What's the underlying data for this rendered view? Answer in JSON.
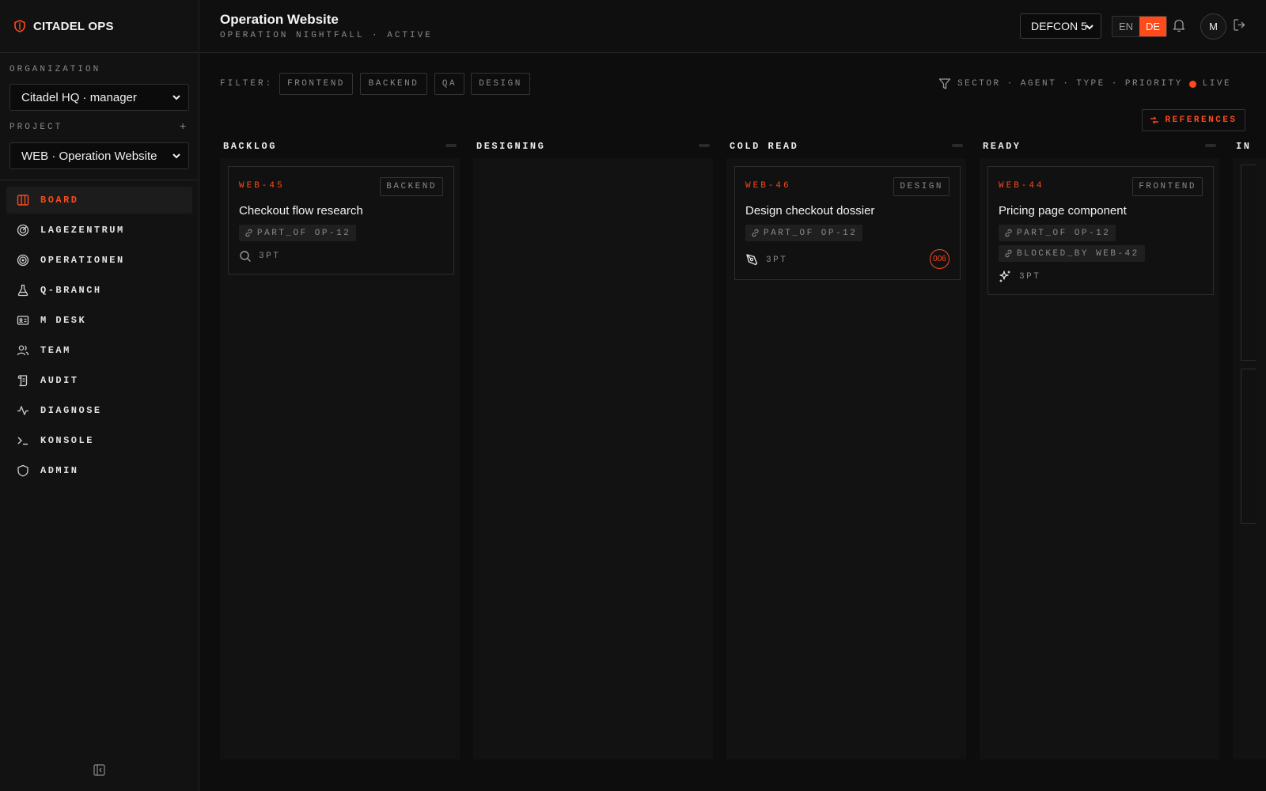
{
  "brand": {
    "name": "CITADEL OPS"
  },
  "sidebar": {
    "org_label": "ORGANIZATION",
    "org_value": "Citadel HQ · manager",
    "project_label": "PROJECT",
    "project_add": "+",
    "project_value": "WEB · Operation Website",
    "items": [
      {
        "label": "BOARD",
        "icon": "board-icon"
      },
      {
        "label": "LAGEZENTRUM",
        "icon": "radar-icon"
      },
      {
        "label": "OPERATIONEN",
        "icon": "target-icon"
      },
      {
        "label": "Q-BRANCH",
        "icon": "flask-icon"
      },
      {
        "label": "M DESK",
        "icon": "id-card-icon"
      },
      {
        "label": "TEAM",
        "icon": "users-icon"
      },
      {
        "label": "AUDIT",
        "icon": "scroll-icon"
      },
      {
        "label": "DIAGNOSE",
        "icon": "activity-icon"
      },
      {
        "label": "KONSOLE",
        "icon": "terminal-icon"
      },
      {
        "label": "ADMIN",
        "icon": "shield-icon"
      }
    ]
  },
  "header": {
    "title": "Operation Website",
    "subtitle": "OPERATION NIGHTFALL · ACTIVE",
    "defcon": "DEFCON 5",
    "lang_en": "EN",
    "lang_de": "DE",
    "avatar": "M"
  },
  "filter": {
    "label": "FILTER:",
    "chips": [
      "FRONTEND",
      "BACKEND",
      "QA",
      "DESIGN"
    ],
    "sector": "SECTOR",
    "agent": "AGENT",
    "type": "TYPE",
    "priority": "PRIORITY",
    "sep": "·",
    "live": "LIVE",
    "references": "REFERENCES"
  },
  "columns": [
    {
      "title": "BACKLOG"
    },
    {
      "title": "DESIGNING"
    },
    {
      "title": "COLD READ"
    },
    {
      "title": "READY"
    },
    {
      "title": "IN"
    }
  ],
  "cards": {
    "c1": {
      "id": "WEB-45",
      "tag": "BACKEND",
      "title": "Checkout flow research",
      "rel1": "PART_OF OP-12",
      "points": "3PT",
      "icon": "search-icon"
    },
    "c2": {
      "id": "WEB-46",
      "tag": "DESIGN",
      "title": "Design checkout dossier",
      "rel1": "PART_OF OP-12",
      "points": "3PT",
      "icon": "pen-tool-icon",
      "badge": "006"
    },
    "c3": {
      "id": "WEB-44",
      "tag": "FRONTEND",
      "title": "Pricing page component",
      "rel1": "PART_OF OP-12",
      "rel2": "BLOCKED_BY WEB-42",
      "points": "3PT",
      "icon": "sparkles-icon"
    }
  },
  "colors": {
    "accent": "#ff4a1c",
    "bg": "#0d0d0d"
  }
}
